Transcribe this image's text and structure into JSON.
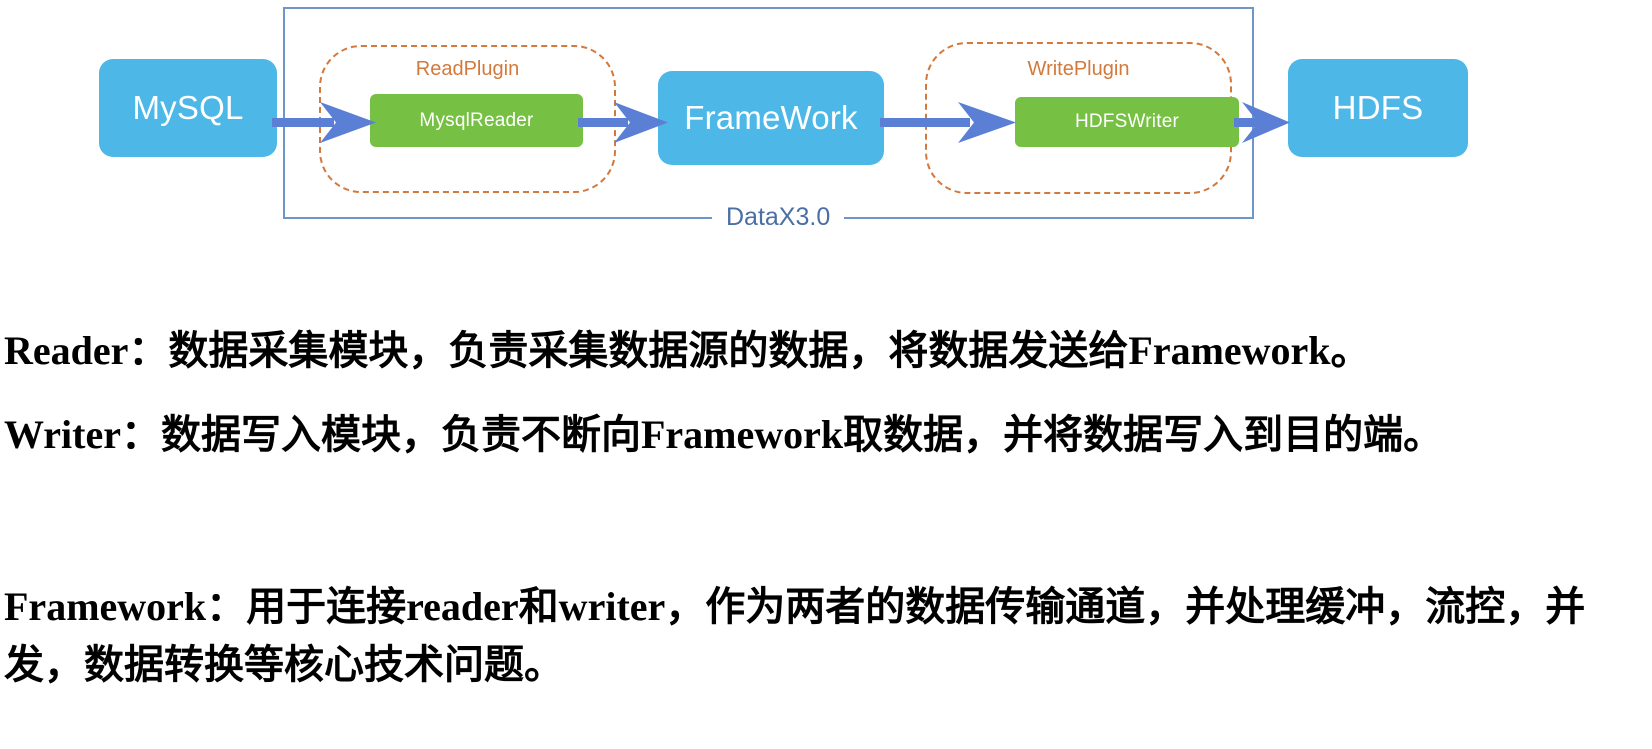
{
  "diagram": {
    "container_label": "DataX3.0",
    "nodes": {
      "source": "MySQL",
      "reader_plugin_label": "ReadPlugin",
      "reader": "MysqlReader",
      "framework": "FrameWork",
      "writer_plugin_label": "WritePlugin",
      "writer": "HDFSWriter",
      "target": "HDFS"
    },
    "colors": {
      "node_blue": "#4db8e8",
      "node_green": "#76c043",
      "arrow_blue": "#5b7fd4",
      "plugin_dash": "#d2793b",
      "container_border": "#6f96c8",
      "datax_label": "#4a6fa5"
    },
    "arrows": [
      {
        "name": "mysql-to-mysqlreader"
      },
      {
        "name": "mysqlreader-to-framework"
      },
      {
        "name": "framework-to-hdfswriter"
      },
      {
        "name": "hdfswriter-to-hdfs"
      }
    ]
  },
  "body": {
    "paragraphs": [
      {
        "id": "reader",
        "text": "Reader：数据采集模块，负责采集数据源的数据，将数据发送给Framework。"
      },
      {
        "id": "writer",
        "text": "Writer：数据写入模块，负责不断向Framework取数据，并将数据写入到目的端。"
      },
      {
        "id": "framework",
        "text": "Framework：用于连接reader和writer，作为两者的数据传输通道，并处理缓冲，流控，并发，数据转换等核心技术问题。"
      }
    ]
  }
}
